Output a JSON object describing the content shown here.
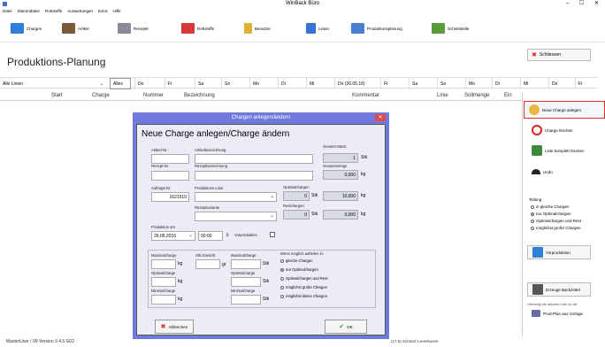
{
  "window": {
    "title": "WinBack Büro",
    "controls": "– ☐ ✕"
  },
  "menu": [
    "Datei",
    "Stammdaten",
    "Rohstoffe",
    "Auswertungen",
    "Extra",
    "Hilfe"
  ],
  "toolbar": [
    "Chargen",
    "Artikel",
    "Rezepte",
    "Rohstoffe",
    "Benutzer",
    "Linien",
    "Produktionsplanung",
    "Schnittstelle"
  ],
  "page": {
    "title": "Produktions-Planung",
    "close_label": "Schliessen"
  },
  "filter": {
    "line_select": "Alle Linien",
    "alles": "Alles",
    "days": [
      "Do",
      "Fr",
      "Sa",
      "So",
      "Mo",
      "Di",
      "Mi",
      "Do (26.05.16)",
      "Fr",
      "Sa",
      "So",
      "Mo",
      "Di",
      "Mi",
      "Do",
      "Fr"
    ]
  },
  "columns": [
    "Start",
    "Charge",
    "Nummer",
    "Bezeichnung",
    "Kommentar",
    "Linie",
    "Sollmenge",
    "Ein"
  ],
  "right_panel": {
    "new_charge": "Neue Charge anlegen",
    "delete_charge": "Charge löschen",
    "delete_line": "Liste komplett löschen",
    "undo": "Undo",
    "split_title": "Teilung",
    "split_options": [
      "in gleiche Chargen",
      "nur Optimalchargen",
      "Optimalchargen und Rest",
      "möglichst große Chargen"
    ],
    "split_selected": 1,
    "vorproduktion": "Vorproduktion",
    "backzettel": "Erzeuge Backzettel",
    "hint1": "Überträgt die aktuelle Liste an die",
    "hint2": "Prod-Plan aus Vorlage"
  },
  "statusbar": {
    "user": "MasterUser / 99   Version 3.4.5 G02",
    "mid": "(17.6) Schmitz Leverkusen"
  },
  "dialog": {
    "title": "Chargen anlegen/ändern",
    "heading": "Neue Charge anlegen/Charge ändern",
    "artikel_nr_label": "Artikel-Nr.:",
    "artikel_bez_label": "Artikelbezeichnung",
    "gesamt_stueck_label": "Gesamt-Stück",
    "gesamt_stueck_value": "1",
    "stk": "Stk",
    "rezept_nr_label": "Rezept-Nr.",
    "rezept_bez_label": "Rezeptbezeichnung",
    "gesamtmenge_label": "Gesamtmenge",
    "gesamtmenge_value": "0,000",
    "kg": "kg",
    "auftrags_nr_label": "Auftrags-Nr.",
    "auftrags_nr_value": "1621510",
    "produktionslinie_label": "Produktions-Linie",
    "optimalchargen_label": "Optimalchargen",
    "optimal_stk": "0",
    "optimal_kg": "10,000",
    "rezeptvariante_label": "Rezeptvariante",
    "restchargen_label": "Restchargen",
    "rest_stk": "0",
    "rest_kg": "0,000",
    "produktion_am_label": "Produktion am",
    "date": "26.05.2016",
    "time": "00:00",
    "vorproduktion_label": "Vorproduktion",
    "max_label": "Maximalcharge",
    "opt_label": "Optimalcharge",
    "min_label": "Minimalcharge",
    "stk_gewicht_label": "Stk.Gewicht",
    "gr": "gr",
    "split_title": "Wenn möglich aufteilen in:",
    "split_options": [
      "gleiche Chargen",
      "nur Optimalchargen",
      "Optimalchargen und Rest",
      "möglichst große Chargen",
      "möglichst kleine Chargen"
    ],
    "split_selected": 1,
    "cancel": "Abbrechen",
    "ok": "OK"
  },
  "colors": {
    "dialog_frame": "#6f79de",
    "highlight": "#e03030",
    "accent": "#3477d6"
  }
}
